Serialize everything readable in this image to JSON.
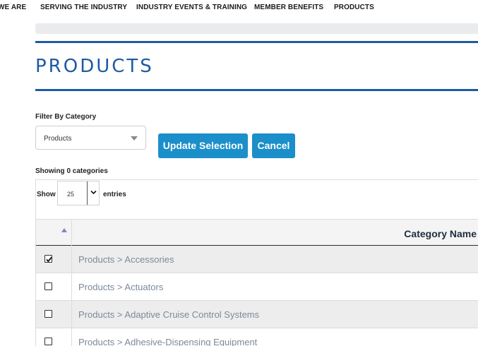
{
  "nav": {
    "items": [
      {
        "label": "WE ARE"
      },
      {
        "label": "SERVING THE INDUSTRY"
      },
      {
        "label": "INDUSTRY EVENTS & TRAINING"
      },
      {
        "label": "MEMBER BENEFITS"
      },
      {
        "label": "PRODUCTS"
      }
    ]
  },
  "page": {
    "title": "PRODUCTS",
    "accent_color": "#1f5aa3",
    "button_color": "#1b8fc9"
  },
  "filter": {
    "label": "Filter By Category",
    "selected": "Products",
    "update_label": "Update Selection",
    "cancel_label": "Cancel"
  },
  "summary": {
    "showing": "Showing 0 categories"
  },
  "table": {
    "length_prefix": "Show",
    "length_value": "25",
    "length_suffix": "entries",
    "column_header": "Category Name",
    "sort_icon": "sort-ascending-icon",
    "rows": [
      {
        "name": "Products > Accessories",
        "checked": true
      },
      {
        "name": "Products > Actuators",
        "checked": false
      },
      {
        "name": "Products > Adaptive Cruise Control Systems",
        "checked": false
      },
      {
        "name": "Products > Adhesive-Dispensing Equipment",
        "checked": false
      }
    ]
  }
}
